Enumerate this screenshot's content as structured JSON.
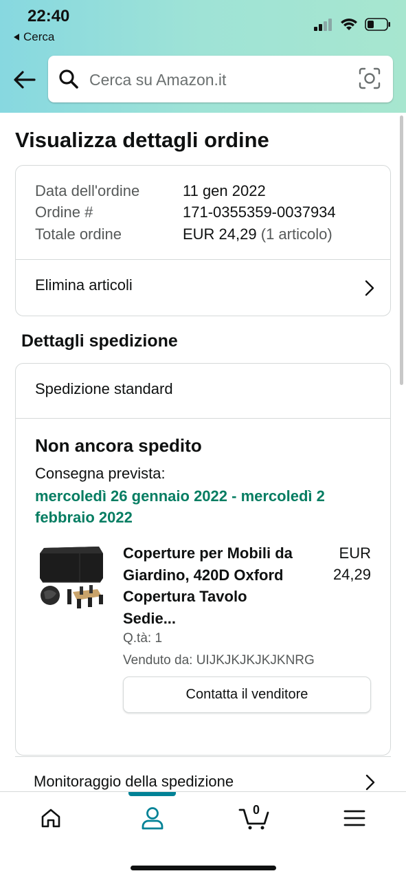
{
  "status_bar": {
    "time": "22:40",
    "back_label": "Cerca"
  },
  "search": {
    "placeholder": "Cerca su Amazon.it"
  },
  "page": {
    "title": "Visualizza dettagli ordine"
  },
  "order_summary": {
    "date_label": "Data dell'ordine",
    "date_value": "11 gen 2022",
    "number_label": "Ordine #",
    "number_value": "171-0355359-0037934",
    "total_label": "Totale ordine",
    "total_value": "EUR 24,29",
    "total_items": "(1 articolo)",
    "delete_items_label": "Elimina articoli"
  },
  "shipment": {
    "section_title": "Dettagli spedizione",
    "shipping_type": "Spedizione standard",
    "status": "Non ancora spedito",
    "eta_label": "Consegna prevista:",
    "eta_dates": "mercoledì 26 gennaio 2022 - mercoledì 2 febbraio 2022",
    "item": {
      "title": "Coperture per Mobili da Giardino, 420D Oxford Copertura Tavolo Sedie...",
      "price_currency": "EUR",
      "price_value": "24,29",
      "quantity": "Q.tà: 1",
      "seller": "Venduto da: UIJKJKJKJKJKNRG",
      "contact_button": "Contatta il venditore"
    },
    "tracking_label": "Monitoraggio della spedizione"
  },
  "tabbar": {
    "items": [
      "home-icon",
      "account-icon",
      "cart-icon",
      "menu-icon"
    ],
    "active": "account-icon",
    "cart_count": "0"
  },
  "colors": {
    "accent_teal": "#008296",
    "delivery_green": "#067d62",
    "header_gradient_start": "#87d8e0",
    "header_gradient_end": "#a7e6cf"
  }
}
